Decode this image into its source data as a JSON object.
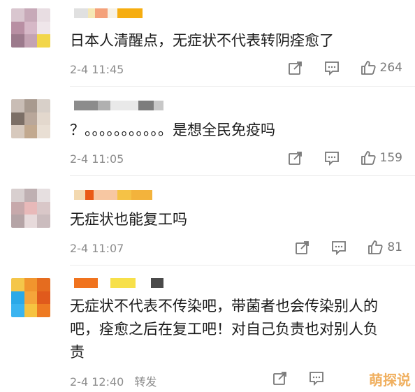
{
  "comments": [
    {
      "text": "日本人清醒点，无症状不代表转阴痊愈了",
      "time": "2-4 11:45",
      "likes": "264",
      "avatar_colors": [
        "#d9c6cf",
        "#c7a9b8",
        "#e8dde2",
        "#b88fa3",
        "#d6b8c7",
        "#efe6ea",
        "#9c7a8c",
        "#c4a3b3",
        "#f2d64a"
      ],
      "name_colors": [
        "#e0e0e0",
        "#f5e7b4",
        "#f4a17a",
        "#f7f1e4",
        "#f6ad10"
      ]
    },
    {
      "text": "？。。。。。。。。。。。是想全民免疫吗",
      "time": "2-4 11:05",
      "likes": "159",
      "avatar_colors": [
        "#c9bdb5",
        "#a89a8f",
        "#d8d0c9",
        "#7c6f66",
        "#b9a79a",
        "#e3d8cd",
        "#d7c9bd",
        "#c2a98f",
        "#e9dfd4"
      ],
      "name_colors": [
        "#8c8c8c",
        "#b0b0b0",
        "#e9e9e9",
        "#7d7d7d",
        "#c8c8c8"
      ]
    },
    {
      "text": "无症状也能复工吗",
      "time": "2-4 11:07",
      "likes": "81",
      "avatar_colors": [
        "#d8cfcf",
        "#bfb0b2",
        "#e6dfe0",
        "#c7a9ab",
        "#e8b9b9",
        "#d9c7c8",
        "#b5a4a6",
        "#e7dadb",
        "#cbbcbe"
      ],
      "name_colors": [
        "#f3d9b0",
        "#ea5a15",
        "#f7c7a2",
        "#f5c246",
        "#f3b33c"
      ]
    },
    {
      "text_lines": [
        "无症状不代表不传染吧，带菌者也会传染别人的",
        "吧，痊愈之后在复工吧！对自己负责也对别人负",
        "责"
      ],
      "time": "2-4 12:40",
      "repost_label": "转发",
      "avatar_colors": [
        "#f4c64a",
        "#f1952e",
        "#e56c1f",
        "#2aa9e8",
        "#f5a53a",
        "#e05a1c",
        "#3ab4f0",
        "#f6c340",
        "#ee7a22"
      ],
      "name_colors": [
        "#f0731e",
        "#ffffff",
        "#f7e04a",
        "#ffffff",
        "#4a4a4a"
      ]
    }
  ],
  "icons": {
    "share": "share-icon",
    "reply": "comment-icon",
    "like": "thumbs-up-icon"
  },
  "watermark": "萌探说"
}
